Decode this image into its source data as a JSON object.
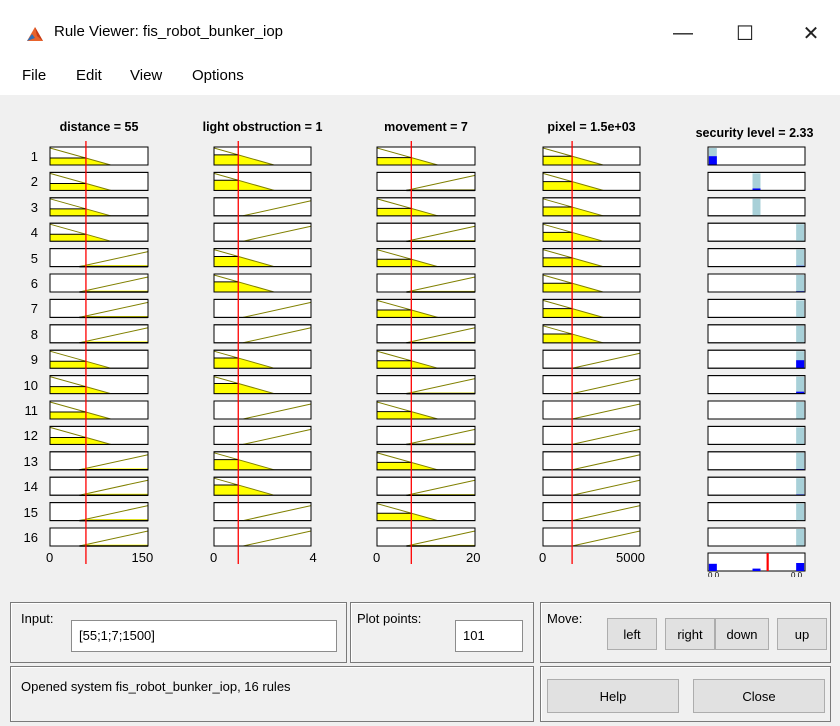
{
  "window": {
    "title": "Rule Viewer: fis_robot_bunker_iop",
    "minimize": "—",
    "maximize": "☐",
    "close": "✕"
  },
  "menu": [
    "File",
    "Edit",
    "View",
    "Options"
  ],
  "inputs": [
    {
      "title": "distance = 55",
      "min_label": "0",
      "max_label": "150",
      "range": [
        0,
        150
      ],
      "value": 55
    },
    {
      "title": "light obstruction = 1",
      "min_label": "0",
      "max_label": "4",
      "range": [
        0,
        4
      ],
      "value": 1
    },
    {
      "title": "movement = 7",
      "min_label": "0",
      "max_label": "20",
      "range": [
        0,
        20
      ],
      "value": 7
    },
    {
      "title": "pixel = 1.5e+03",
      "min_label": "0",
      "max_label": "5000",
      "range": [
        0,
        5000
      ],
      "value": 1500
    }
  ],
  "output": {
    "title": "security level = 2.33",
    "min_label": "0.0",
    "max_label": "0.0",
    "value_fraction": 0.82
  },
  "rule_numbers": [
    "1",
    "2",
    "3",
    "4",
    "5",
    "6",
    "7",
    "8",
    "9",
    "10",
    "11",
    "12",
    "13",
    "14",
    "15",
    "16"
  ],
  "rules": [
    {
      "mf": [
        "low",
        "low",
        "low",
        "low"
      ],
      "out": 0.05,
      "fire": 0.55
    },
    {
      "mf": [
        "low",
        "low",
        "high",
        "low"
      ],
      "out": 0.5,
      "fire": 0.12
    },
    {
      "mf": [
        "low",
        "high",
        "low",
        "low"
      ],
      "out": 0.5,
      "fire": 0.0
    },
    {
      "mf": [
        "low",
        "high",
        "high",
        "low"
      ],
      "out": 0.95,
      "fire": 0.0
    },
    {
      "mf": [
        "high",
        "low",
        "low",
        "low"
      ],
      "out": 0.95,
      "fire": 0.05
    },
    {
      "mf": [
        "high",
        "low",
        "high",
        "low"
      ],
      "out": 0.95,
      "fire": 0.05
    },
    {
      "mf": [
        "high",
        "high",
        "low",
        "low"
      ],
      "out": 0.95,
      "fire": 0.0
    },
    {
      "mf": [
        "high",
        "high",
        "high",
        "low"
      ],
      "out": 0.95,
      "fire": 0.0
    },
    {
      "mf": [
        "low",
        "low",
        "low",
        "high"
      ],
      "out": 0.95,
      "fire": 0.5
    },
    {
      "mf": [
        "low",
        "low",
        "high",
        "high"
      ],
      "out": 0.95,
      "fire": 0.12
    },
    {
      "mf": [
        "low",
        "high",
        "low",
        "high"
      ],
      "out": 0.95,
      "fire": 0.0
    },
    {
      "mf": [
        "low",
        "high",
        "high",
        "high"
      ],
      "out": 0.95,
      "fire": 0.0
    },
    {
      "mf": [
        "high",
        "low",
        "low",
        "high"
      ],
      "out": 0.95,
      "fire": 0.05
    },
    {
      "mf": [
        "high",
        "low",
        "high",
        "high"
      ],
      "out": 0.95,
      "fire": 0.05
    },
    {
      "mf": [
        "high",
        "high",
        "low",
        "high"
      ],
      "out": 0.95,
      "fire": 0.0
    },
    {
      "mf": [
        "high",
        "high",
        "high",
        "high"
      ],
      "out": 0.95,
      "fire": 0.0
    }
  ],
  "controls": {
    "input_label": "Input:",
    "input_value": "[55;1;7;1500]",
    "plot_points_label": "Plot points:",
    "plot_points_value": "101",
    "move_label": "Move:",
    "move_buttons": [
      "left",
      "right",
      "down",
      "up"
    ],
    "help": "Help",
    "close": "Close",
    "status": "Opened system fis_robot_bunker_iop, 16 rules"
  },
  "colors": {
    "membership_fill": "#ffff00",
    "membership_line": "#808000",
    "input_value_line": "#ff0000",
    "output_fill": "#a8d0d8",
    "output_firing": "#0000ff"
  }
}
